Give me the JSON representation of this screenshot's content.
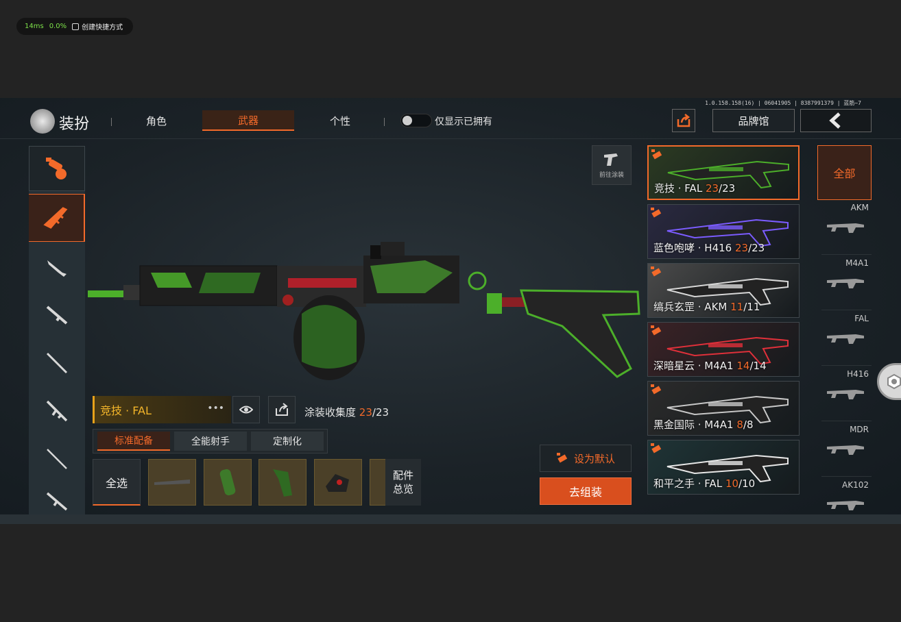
{
  "overlay": {
    "latency": "14ms",
    "loss": "0.0%",
    "shortcut": "创建快捷方式"
  },
  "version": "1.0.158.158(16) | 06041905 | 8387991379 | 蓝筋~7",
  "header": {
    "title": "装扮",
    "tabs": [
      {
        "label": "角色",
        "active": false
      },
      {
        "label": "武器",
        "active": true
      },
      {
        "label": "个性",
        "active": false
      }
    ],
    "toggle_label": "仅显示已拥有",
    "brand_label": "品牌馆"
  },
  "goto_paint": "前往涂装",
  "weapon": {
    "name": "竞技 · FAL",
    "collect_label": "涂装收集度",
    "collect_current": "23",
    "collect_total": "/23"
  },
  "subtabs": [
    "标准配备",
    "全能射手",
    "定制化"
  ],
  "select_all": "全选",
  "parts_overview": [
    "配件",
    "总览"
  ],
  "set_default": "设为默认",
  "assemble": "去组装",
  "skins": [
    {
      "name": "竞技 · FAL ",
      "have": "23",
      "total": "/23",
      "bg": "#2b3a22",
      "accent": "#4caf2a"
    },
    {
      "name": "蓝色咆哮 · H416 ",
      "have": "23",
      "total": "/23",
      "bg": "#2a2940",
      "accent": "#7b5cff"
    },
    {
      "name": "缟兵玄罡 · AKM ",
      "have": "11",
      "total": "/11",
      "bg": "#4a4a4a",
      "accent": "#d8d8d8"
    },
    {
      "name": "深暗星云 · M4A1 ",
      "have": "14",
      "total": "/14",
      "bg": "#3a2226",
      "accent": "#e0303a"
    },
    {
      "name": "黑金国际 · M4A1 ",
      "have": "8",
      "total": "/8",
      "bg": "#2b2b2b",
      "accent": "#c8c8c8"
    },
    {
      "name": "和平之手 · FAL ",
      "have": "10",
      "total": "/10",
      "bg": "#1f3436",
      "accent": "#e8e8e8"
    }
  ],
  "categories": {
    "all": "全部",
    "items": [
      "AKM",
      "M4A1",
      "FAL",
      "H416",
      "MDR",
      "AK102"
    ]
  },
  "colors": {
    "accent": "#f36a2a",
    "gold": "#f3b52a",
    "camo_green": "#4caf2a"
  }
}
